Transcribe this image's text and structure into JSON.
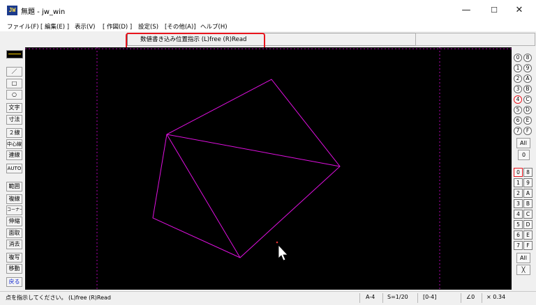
{
  "window": {
    "app_icon_text": "JW",
    "title": "無題 - jw_win",
    "minimize": "—",
    "maximize": "☐",
    "close": "✕"
  },
  "menu": [
    "ファイル(F)",
    "[ 編集(E) ]",
    "表示(V)",
    "[ 作図(D) ]",
    "設定(S)",
    "[その他(A)]",
    "ヘルプ(H)"
  ],
  "message": "数値書き込み位置指示 (L)free (R)Read",
  "left_tools": [
    "／",
    "□",
    "○",
    "文字",
    "寸法",
    "２線",
    "中心線",
    "連線",
    "AUTO",
    "範囲",
    "複線",
    "コーナー",
    "伸縮",
    "面取",
    "消去",
    "複写",
    "移動",
    "戻る"
  ],
  "right_panel": {
    "circle_left": [
      "0",
      "1",
      "2",
      "3",
      "4",
      "5",
      "6",
      "7"
    ],
    "circle_right": [
      "8",
      "9",
      "A",
      "B",
      "C",
      "D",
      "E",
      "F"
    ],
    "all_label": "All",
    "zero_label": "0",
    "layer_left": [
      "0",
      "1",
      "2",
      "3",
      "4",
      "5",
      "6",
      "7"
    ],
    "layer_right": [
      "8",
      "9",
      "A",
      "B",
      "C",
      "D",
      "E",
      "F"
    ],
    "all_label2": "All",
    "x_label": "╳"
  },
  "status": {
    "prompt": "点を指示してください。 (L)free (R)Read",
    "paper": "A-4",
    "scale": "S=1/20",
    "layer": "[0-4]",
    "angle": "∠0",
    "zoom": "× 0.34"
  },
  "colors": {
    "canvas": "#000000",
    "drawing_line": "#e010e0",
    "guide_line": "#b000b0",
    "highlight": "#e8141d",
    "line_sample": "#ffd400"
  }
}
